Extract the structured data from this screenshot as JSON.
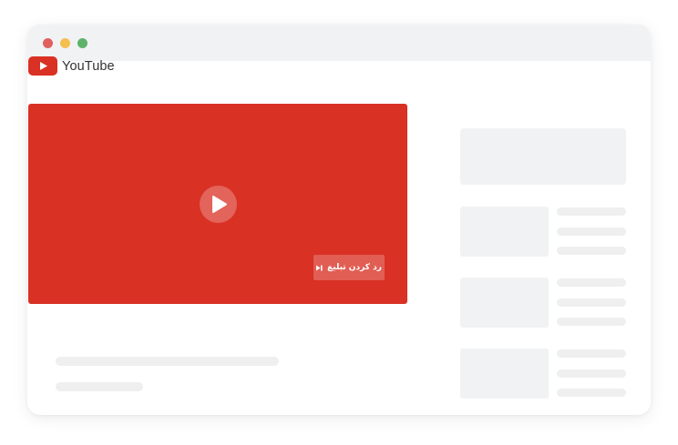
{
  "window": {
    "controls": [
      {
        "name": "close",
        "color": "#e0605f"
      },
      {
        "name": "minimize",
        "color": "#f4bf4f"
      },
      {
        "name": "maximize",
        "color": "#5fb26a"
      }
    ]
  },
  "logo": {
    "text": "YouTube",
    "icon": "play-icon",
    "brand_color": "#d93124"
  },
  "player": {
    "background": "#d93124",
    "play_icon": "play-icon",
    "skip_ad_label": "رد کردن تبلیغ",
    "skip_icon": "skip-next-icon"
  },
  "colors": {
    "placeholder": "#efeff0",
    "titlebar": "#f1f2f4"
  }
}
